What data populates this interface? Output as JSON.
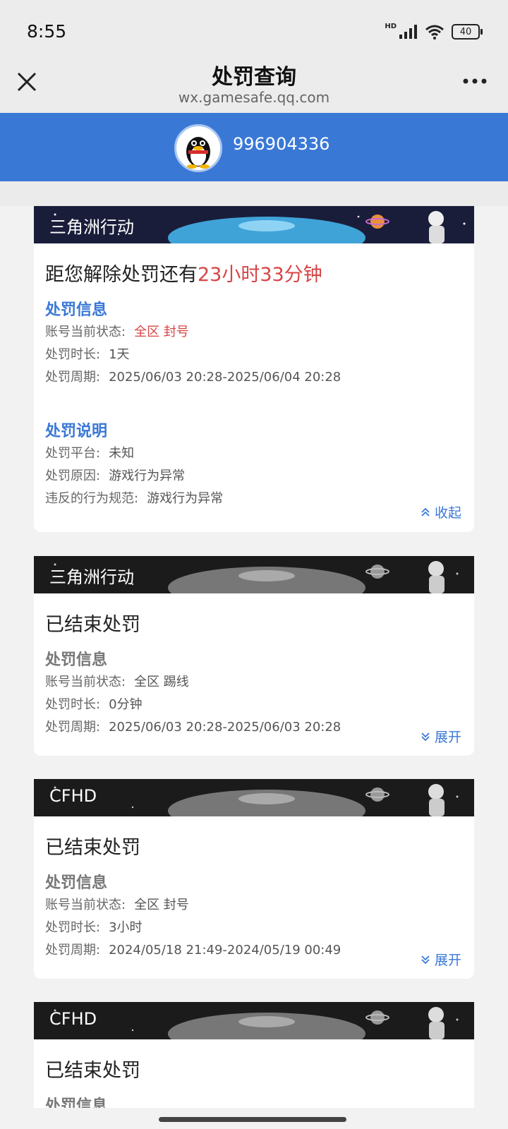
{
  "status": {
    "time": "8:55",
    "hd": "HD",
    "battery": "40"
  },
  "nav": {
    "title": "处罚查询",
    "url": "wx.gamesafe.qq.com"
  },
  "user": {
    "id": "996904336"
  },
  "cards": [
    {
      "game": "三角洲行动",
      "headline_prefix": "距您解除处罚还有",
      "headline_highlight": "23小时33分钟",
      "info_title": "处罚信息",
      "rows": [
        {
          "label": "账号当前状态:",
          "value": "全区 封号",
          "red": true
        },
        {
          "label": "处罚时长:",
          "value": "1天"
        },
        {
          "label": "处罚周期:",
          "value": "2025/06/03 20:28-2025/06/04 20:28"
        }
      ],
      "desc_title": "处罚说明",
      "desc_rows": [
        {
          "label": "处罚平台:",
          "value": "未知"
        },
        {
          "label": "处罚原因:",
          "value": "游戏行为异常"
        },
        {
          "label": "违反的行为规范:",
          "value": "游戏行为异常"
        }
      ],
      "toggle": "收起"
    },
    {
      "game": "三角洲行动",
      "headline": "已结束处罚",
      "info_title": "处罚信息",
      "rows": [
        {
          "label": "账号当前状态:",
          "value": "全区 踢线"
        },
        {
          "label": "处罚时长:",
          "value": "0分钟"
        },
        {
          "label": "处罚周期:",
          "value": "2025/06/03 20:28-2025/06/03 20:28"
        }
      ],
      "toggle": "展开"
    },
    {
      "game": "CFHD",
      "headline": "已结束处罚",
      "info_title": "处罚信息",
      "rows": [
        {
          "label": "账号当前状态:",
          "value": "全区 封号"
        },
        {
          "label": "处罚时长:",
          "value": "3小时"
        },
        {
          "label": "处罚周期:",
          "value": "2024/05/18 21:49-2024/05/19 00:49"
        }
      ],
      "toggle": "展开"
    },
    {
      "game": "CFHD",
      "headline": "已结束处罚",
      "info_title": "处罚信息"
    }
  ],
  "colors": {
    "accent": "#3a78d6",
    "alert": "#d64545"
  }
}
